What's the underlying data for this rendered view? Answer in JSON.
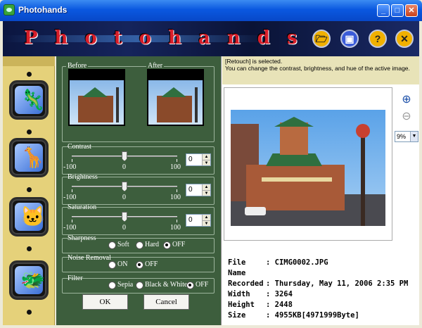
{
  "window": {
    "title": "Photohands",
    "app_icon": "photohands-app-icon",
    "controls": [
      "minimize-icon",
      "maximize-icon",
      "close-icon"
    ]
  },
  "banner": {
    "logo": "Photohands",
    "buttons": [
      {
        "name": "open-folder-icon",
        "color": "#f0b000"
      },
      {
        "name": "save-icon",
        "color": "#3a5bd8"
      },
      {
        "name": "help-icon",
        "color": "#f0b000"
      },
      {
        "name": "close-icon",
        "color": "#f0b000"
      }
    ]
  },
  "sidebar": {
    "tools": [
      {
        "name": "chameleon-icon",
        "glyph": "🦎"
      },
      {
        "name": "giraffe-icon",
        "glyph": "🦒"
      },
      {
        "name": "cat-icon",
        "glyph": "🐱"
      },
      {
        "name": "dragon-icon",
        "glyph": "🐲"
      }
    ]
  },
  "panel": {
    "before_label": "Before",
    "after_label": "After",
    "sliders": [
      {
        "label": "Contrast",
        "min": "-100",
        "mid": "0",
        "max": "100",
        "value": "0",
        "level": 0
      },
      {
        "label": "Brightness",
        "min": "-100",
        "mid": "0",
        "max": "100",
        "value": "0",
        "level": 0
      },
      {
        "label": "Saturation",
        "min": "-100",
        "mid": "0",
        "max": "100",
        "value": "0",
        "level": 0
      }
    ],
    "sharpness": {
      "label": "Sharpness",
      "options": [
        "Soft",
        "Hard",
        "OFF"
      ],
      "selected": "OFF"
    },
    "noise": {
      "label": "Noise Removal",
      "options": [
        "ON",
        "OFF"
      ],
      "selected": "OFF"
    },
    "filter": {
      "label": "Filter",
      "options": [
        "Sepia",
        "Black & White",
        "OFF"
      ],
      "selected": "OFF"
    },
    "ok_label": "OK",
    "cancel_label": "Cancel"
  },
  "info": {
    "line1": "[Retouch] is selected.",
    "line2": "You can change the contrast, brightness, and hue of the active image."
  },
  "zoom": {
    "level": "9%",
    "in_icon": "zoom-in-icon",
    "out_icon": "zoom-out-icon"
  },
  "file": [
    {
      "key": "File Name",
      "value": "CIMG0002.JPG"
    },
    {
      "key": "Recorded",
      "value": "Thursday, May 11, 2006 2:35 PM"
    },
    {
      "key": "Width",
      "value": "3264"
    },
    {
      "key": "Height",
      "value": "2448"
    },
    {
      "key": "Size",
      "value": "4955KB[4971999Byte]"
    }
  ]
}
